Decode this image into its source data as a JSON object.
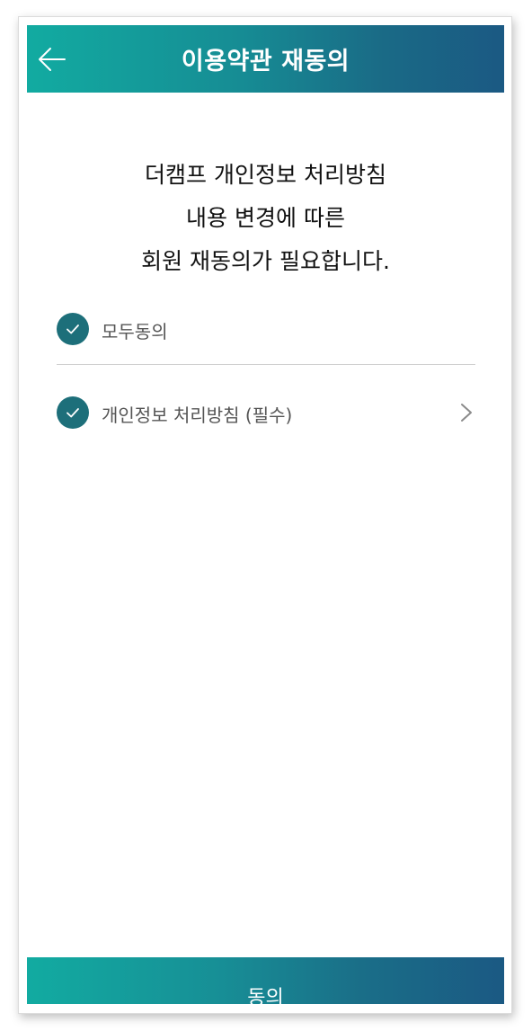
{
  "header": {
    "title": "이용약관 재동의",
    "back_icon": "arrow-left-icon"
  },
  "notice": {
    "lines": [
      "더캠프 개인정보 처리방침",
      "내용 변경에 따른",
      "회원 재동의가 필요합니다."
    ]
  },
  "agreements": {
    "all": {
      "label": "모두동의",
      "checked": true,
      "icon": "check-circle-icon"
    },
    "items": [
      {
        "label": "개인정보 처리방침 (필수)",
        "checked": true,
        "icon": "check-circle-icon",
        "detail_icon": "chevron-right-icon"
      }
    ]
  },
  "footer": {
    "agree_label": "동의"
  },
  "colors": {
    "gradient_start": "#12aba1",
    "gradient_end": "#1b5983",
    "check_fill": "#1d6f7a"
  }
}
